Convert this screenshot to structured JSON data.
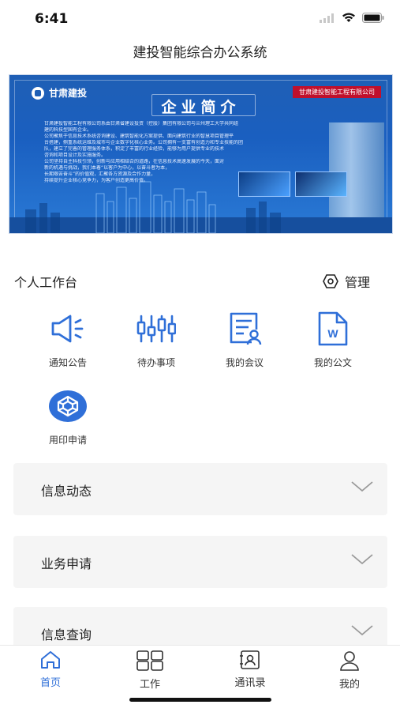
{
  "status": {
    "time": "6:41"
  },
  "header": {
    "title": "建投智能综合办公系统"
  },
  "banner": {
    "logo_text": "甘肃建投",
    "company_tag": "甘肃建投智能工程有限公司",
    "title": "企业简介",
    "paragraph_lines": [
      "甘肃建投智能工程有限公司系由甘肃省建设投资（控股）集团有限公司与兰州理工大学共同组",
      "建的科技型国有企业。",
      "公司聚焦于信息技术系统咨询建设、建筑智能化方案提供、面向建筑行业的智慧项目管理平",
      "台搭建，侧重系统运维及城市与企业数字化核心业务。公司拥有一支富有创造力和专业技能的团",
      "队，建立了完善的管理服务体系，积淀了丰富的行业经验，能够为用户提供专业的技术",
      "咨询和项目设计及实施服务。",
      "公司坚持自主科技引领，创新与应用相结合的道路，在信息技术高速发展的今天，面对",
      "新的机遇与挑战，我们本着“以客户为中心，以奋斗者为本，",
      "长期艰苦奋斗”的价值观，汇聚各方资源及合作力量，",
      "持续提升企业核心竞争力，为客户创造更高价值。"
    ]
  },
  "workbench": {
    "title": "个人工作台",
    "manage_label": "管理",
    "items": [
      {
        "label": "通知公告",
        "icon": "megaphone-icon"
      },
      {
        "label": "待办事项",
        "icon": "sliders-icon"
      },
      {
        "label": "我的会议",
        "icon": "meeting-doc-icon"
      },
      {
        "label": "我的公文",
        "icon": "word-doc-icon"
      },
      {
        "label": "用印申请",
        "icon": "seal-icon"
      }
    ]
  },
  "sections": [
    {
      "label": "信息动态"
    },
    {
      "label": "业务申请"
    },
    {
      "label": "信息查询"
    }
  ],
  "tabs": [
    {
      "label": "首页",
      "icon": "home-icon",
      "active": true
    },
    {
      "label": "工作",
      "icon": "grid-icon",
      "active": false
    },
    {
      "label": "通讯录",
      "icon": "contacts-icon",
      "active": false
    },
    {
      "label": "我的",
      "icon": "user-icon",
      "active": false
    }
  ],
  "colors": {
    "accent": "#2f6fd8",
    "icon_blue": "#2f6fd8",
    "tab_inactive": "#333333",
    "section_bg": "#f5f5f5"
  }
}
